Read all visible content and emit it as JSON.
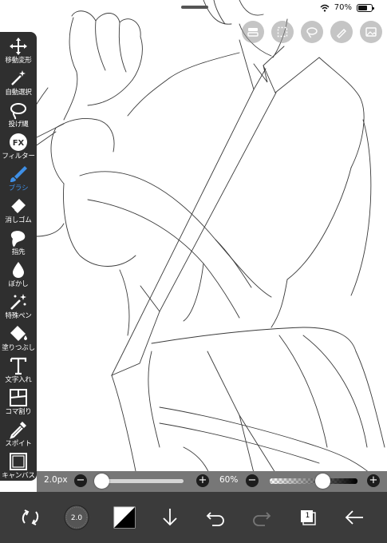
{
  "status": {
    "battery_text": "70%",
    "battery_level": 0.7
  },
  "top_tools": [
    "layer-eye-icon",
    "selection-icon",
    "lasso-icon",
    "pen-icon",
    "image-icon"
  ],
  "toolbar": {
    "tools": [
      {
        "name": "transform",
        "label": "移動変形",
        "icon": "move-arrows-icon"
      },
      {
        "name": "magic-wand",
        "label": "自動選択",
        "icon": "magic-wand-icon"
      },
      {
        "name": "lasso",
        "label": "投げ縄",
        "icon": "lasso-icon"
      },
      {
        "name": "filter",
        "label": "フィルター",
        "icon": "fx-icon"
      },
      {
        "name": "brush",
        "label": "ブラシ",
        "icon": "brush-icon",
        "active": true
      },
      {
        "name": "eraser",
        "label": "消しゴム",
        "icon": "eraser-icon"
      },
      {
        "name": "smudge",
        "label": "指先",
        "icon": "finger-icon"
      },
      {
        "name": "blur",
        "label": "ぼかし",
        "icon": "drop-icon"
      },
      {
        "name": "special-pen",
        "label": "特殊ペン",
        "icon": "sparkle-pen-icon"
      },
      {
        "name": "fill",
        "label": "塗りつぶし",
        "icon": "bucket-icon"
      },
      {
        "name": "text",
        "label": "文字入れ",
        "icon": "text-icon"
      },
      {
        "name": "frame",
        "label": "コマ割り",
        "icon": "frame-divider-icon"
      },
      {
        "name": "eyedropper",
        "label": "スポイト",
        "icon": "eyedropper-icon"
      },
      {
        "name": "canvas",
        "label": "キャンバス",
        "icon": "canvas-icon"
      }
    ]
  },
  "sliders": {
    "size_label": "2.0px",
    "size_value": 2.0,
    "size_fraction": 0.0,
    "opacity_label": "60%",
    "opacity_fraction": 0.6,
    "minus": "−",
    "plus": "+"
  },
  "bottom": {
    "brush_size_badge": "2.0",
    "layer_count": "1",
    "color_primary": "#000000",
    "color_secondary": "#ffffff",
    "accent": "#3f8fe6"
  }
}
